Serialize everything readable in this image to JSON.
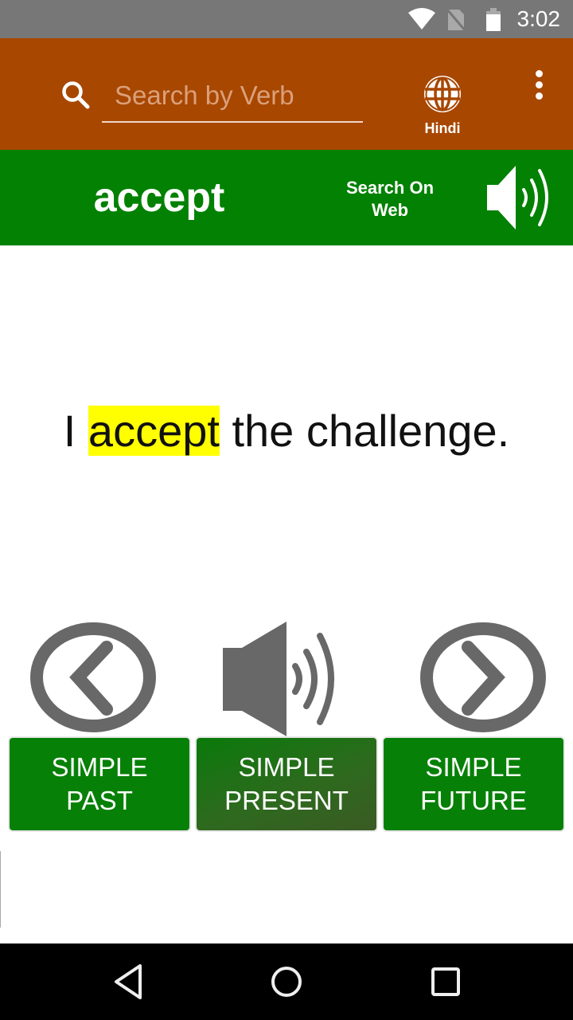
{
  "status_bar": {
    "time": "3:02",
    "icons": [
      "wifi-icon",
      "no-sim-icon",
      "battery-icon"
    ]
  },
  "toolbar": {
    "search_placeholder": "Search by Verb",
    "search_value": "",
    "language_label": "Hindi",
    "colors": {
      "background": "#a84700"
    }
  },
  "verb_bar": {
    "verb": "accept",
    "search_web_line1": "Search On",
    "search_web_line2": "Web",
    "colors": {
      "background": "#028102"
    }
  },
  "sentence": {
    "before": "I ",
    "highlight": "accept",
    "after": " the challenge.",
    "highlight_color": "#ffff00"
  },
  "controls": {
    "previous": "previous-icon",
    "speak": "speaker-icon",
    "next": "next-icon"
  },
  "tenses": [
    {
      "line1": "SIMPLE",
      "line2": "PAST",
      "active": false
    },
    {
      "line1": "SIMPLE",
      "line2": "PRESENT",
      "active": true
    },
    {
      "line1": "SIMPLE",
      "line2": "FUTURE",
      "active": false
    }
  ],
  "nav_bar": {
    "buttons": [
      "back",
      "home",
      "recents"
    ]
  }
}
